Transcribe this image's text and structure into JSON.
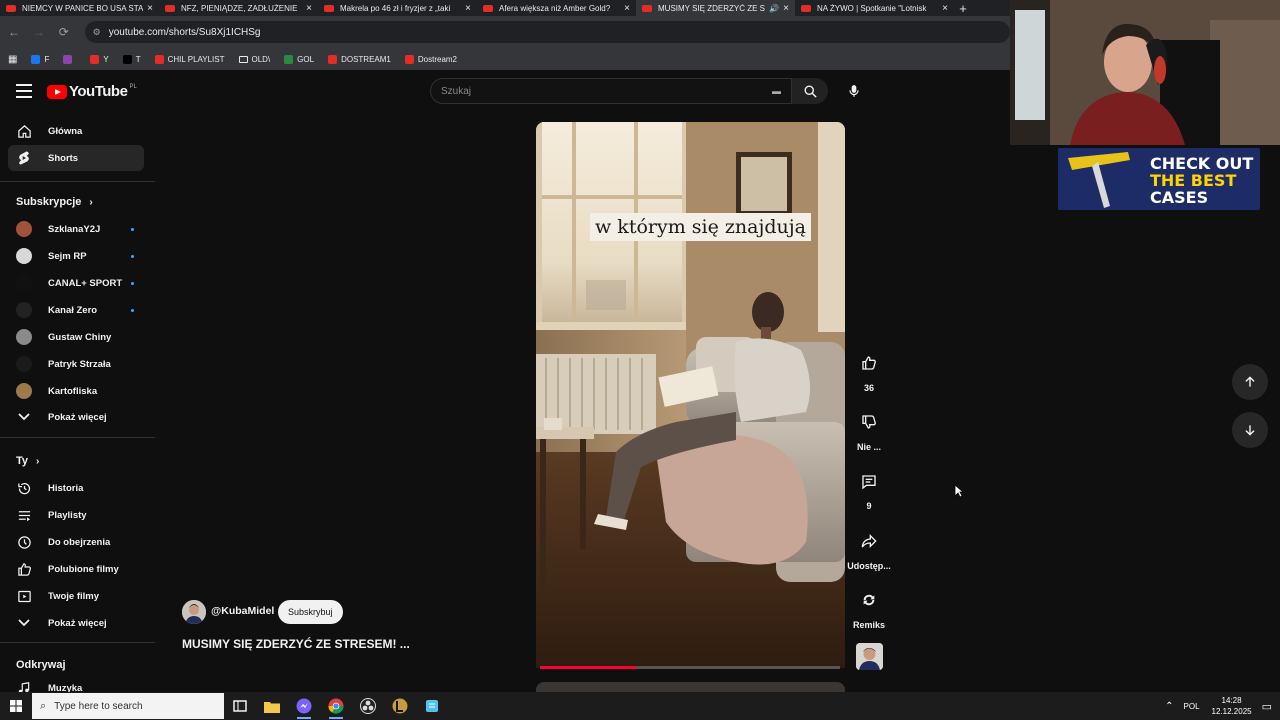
{
  "browser": {
    "tabs": [
      {
        "title": "NIEMCY W PANICE BO USA STA",
        "active": false
      },
      {
        "title": "NFZ, PIENIĄDZE, ZADŁUŻENIE",
        "active": false
      },
      {
        "title": "Makrela po 46 zł i fryzjer z „taki",
        "active": false
      },
      {
        "title": "Afera większa niż Amber Gold?",
        "active": false
      },
      {
        "title": "MUSIMY SIĘ ZDERZYĆ ZE S",
        "active": true
      },
      {
        "title": "NA ŻYWO | Spotkanie \"Lotnisk",
        "active": false
      }
    ],
    "url": "youtube.com/shorts/Su8Xj1ICHSg",
    "bookmarks": [
      {
        "label": "F",
        "color": "#1877f2"
      },
      {
        "label": "",
        "color": "#8e44ad"
      },
      {
        "label": "Y",
        "color": "#e52d27"
      },
      {
        "label": "T",
        "color": "#000000"
      },
      {
        "label": "CHIL PLAYLIST",
        "color": "#e52d27"
      },
      {
        "label": "OLD\\",
        "color": "folder"
      },
      {
        "label": "GOL",
        "color": "#2b8a3e"
      },
      {
        "label": "DOSTREAM1",
        "color": "#e52d27"
      },
      {
        "label": "Dostream2",
        "color": "#e52d27"
      }
    ]
  },
  "youtube": {
    "logo_text": "YouTube",
    "region": "PL",
    "search_placeholder": "Szukaj",
    "sidebar": {
      "main": [
        {
          "label": "Główna",
          "icon": "home-icon",
          "active": false
        },
        {
          "label": "Shorts",
          "icon": "shorts-icon",
          "active": true
        }
      ],
      "subscriptions_header": "Subskrypcje",
      "subscriptions": [
        {
          "label": "SzklanaY2J",
          "avatar_color": "#a0523a",
          "dot": true
        },
        {
          "label": "Sejm RP",
          "avatar_color": "#d8d8d8",
          "dot": true
        },
        {
          "label": "CANAL+ SPORT",
          "avatar_color": "#111111",
          "dot": true
        },
        {
          "label": "Kanał Zero",
          "avatar_color": "#222222",
          "dot": true
        },
        {
          "label": "Gustaw Chiny",
          "avatar_color": "#8a8a8a",
          "dot": false
        },
        {
          "label": "Patryk Strzała",
          "avatar_color": "#1a1a1a",
          "dot": false
        },
        {
          "label": "Kartofliska",
          "avatar_color": "#9c7a4b",
          "dot": false
        }
      ],
      "show_more_1": "Pokaż więcej",
      "you_header": "Ty",
      "you_items": [
        {
          "label": "Historia",
          "icon": "history-icon"
        },
        {
          "label": "Playlisty",
          "icon": "playlists-icon"
        },
        {
          "label": "Do obejrzenia",
          "icon": "watch-later-icon"
        },
        {
          "label": "Polubione filmy",
          "icon": "liked-icon"
        },
        {
          "label": "Twoje filmy",
          "icon": "your-videos-icon"
        }
      ],
      "show_more_2": "Pokaż więcej",
      "explore_header": "Odkrywaj",
      "explore_items": [
        {
          "label": "Muzyka",
          "icon": "music-icon"
        }
      ]
    },
    "short": {
      "caption": "w którym się znajdują",
      "progress": 0.32,
      "channel": "@KubaMidel",
      "subscribe_label": "Subskrybuj",
      "title": "MUSIMY SIĘ ZDERZYĆ ZE STRESEM! ...",
      "actions": {
        "like_count": "36",
        "dislike_label": "Nie ...",
        "comments_count": "9",
        "share_label": "Udostęp...",
        "remix_label": "Remiks"
      }
    }
  },
  "overlay": {
    "ad_line1": "CHECK OUT",
    "ad_line2": "THE BEST",
    "ad_line3": "CASES"
  },
  "taskbar": {
    "search_placeholder": "Type here to search",
    "language": "POL",
    "time": "14:28",
    "date": "12.12.2025"
  }
}
